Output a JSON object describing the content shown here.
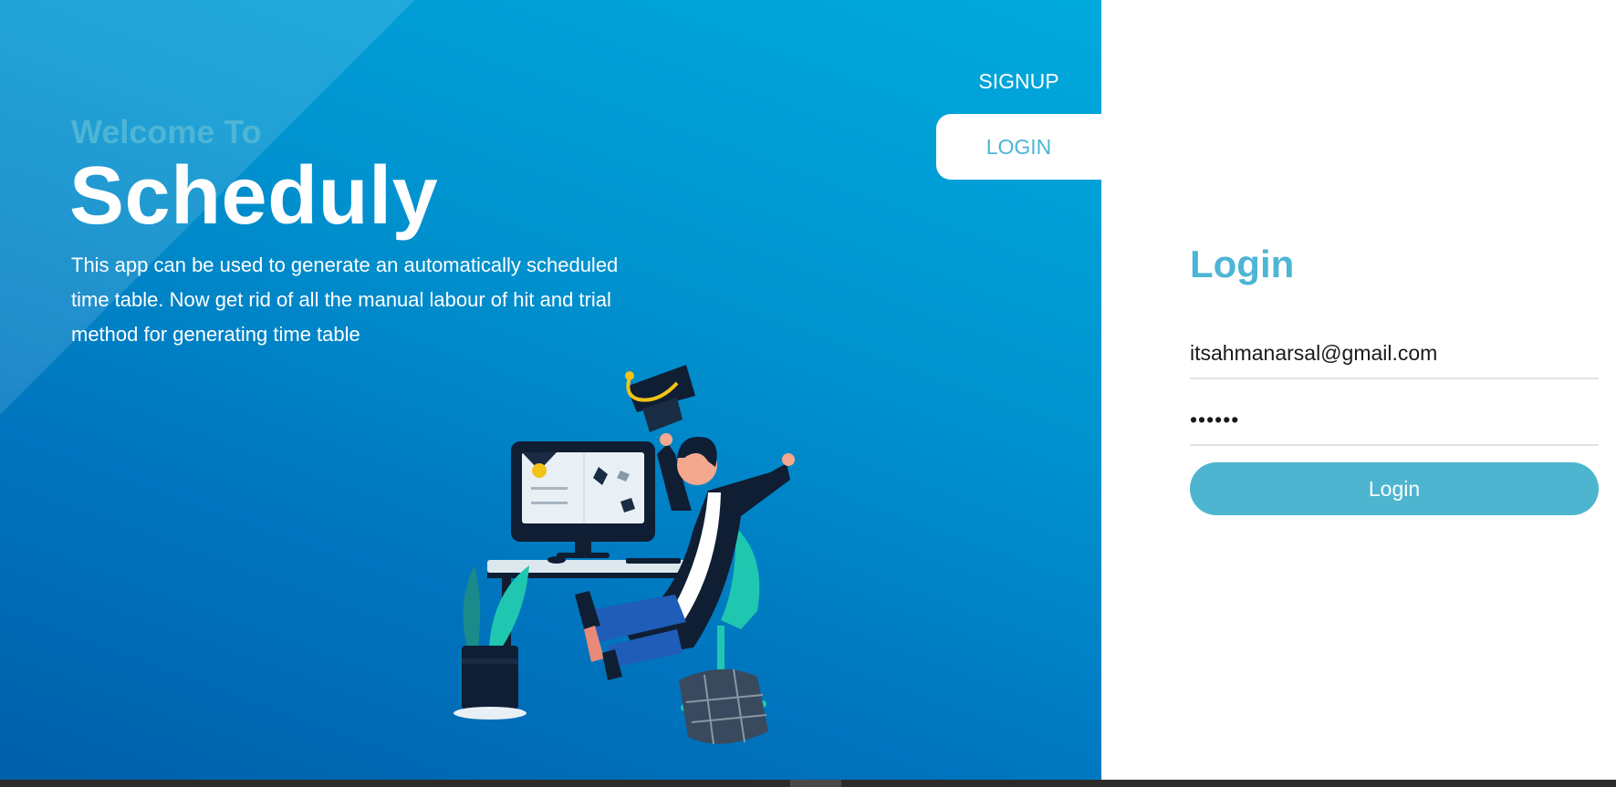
{
  "hero": {
    "welcome": "Welcome To",
    "brand": "Scheduly",
    "description": "This app can be used to generate an automatically scheduled time table. Now get rid of all the manual labour of hit and trial method for generating time table"
  },
  "nav": {
    "signup": "SIGNUP",
    "login": "LOGIN"
  },
  "form": {
    "title": "Login",
    "email_value": "itsahmanarsal@gmail.com",
    "password_value": "••••••",
    "button_label": "Login"
  },
  "colors": {
    "accent": "#4db5d6",
    "hero_top": "#00aadd",
    "hero_bottom": "#005fa9"
  },
  "illustration": "graduate-celebrating-illustration"
}
